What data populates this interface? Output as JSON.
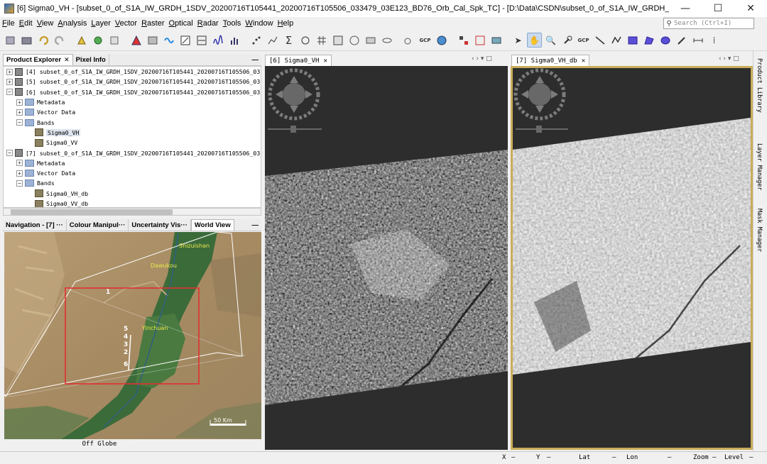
{
  "window": {
    "title": "[6] Sigma0_VH - [subset_0_of_S1A_IW_GRDH_1SDV_20200716T105441_20200716T105506_033479_03E123_BD76_Orb_Cal_Spk_TC] - [D:\\Data\\CSDN\\subset_0_of_S1A_IW_GRDH_1SDV_20200716T105441_2...",
    "minimize": "—",
    "maximize": "☐",
    "close": "✕"
  },
  "menu": [
    "File",
    "Edit",
    "View",
    "Analysis",
    "Layer",
    "Vector",
    "Raster",
    "Optical",
    "Radar",
    "Tools",
    "Window",
    "Help"
  ],
  "search": {
    "placeholder": "Search (Ctrl+I)"
  },
  "toolbar": {
    "gcp_label": "GCP"
  },
  "product_explorer": {
    "tabs": [
      "Product Explorer",
      "Pixel Info"
    ],
    "tab_close": "✕",
    "minimize": "—",
    "tree": [
      {
        "indent": 0,
        "exp": "+",
        "icon": "product",
        "label": "[4] subset_0_of_S1A_IW_GRDH_1SDV_20200716T105441_20200716T105506_03"
      },
      {
        "indent": 0,
        "exp": "+",
        "icon": "product",
        "label": "[5] subset_0_of_S1A_IW_GRDH_1SDV_20200716T105441_20200716T105506_03"
      },
      {
        "indent": 0,
        "exp": "−",
        "icon": "product",
        "label": "[6] subset_0_of_S1A_IW_GRDH_1SDV_20200716T105441_20200716T105506_03"
      },
      {
        "indent": 1,
        "exp": "+",
        "icon": "folder",
        "label": "Metadata"
      },
      {
        "indent": 1,
        "exp": "+",
        "icon": "folder",
        "label": "Vector Data"
      },
      {
        "indent": 1,
        "exp": "−",
        "icon": "folder",
        "label": "Bands"
      },
      {
        "indent": 2,
        "exp": "",
        "icon": "band",
        "label": "Sigma0_VH",
        "selected": true
      },
      {
        "indent": 2,
        "exp": "",
        "icon": "band",
        "label": "Sigma0_VV"
      },
      {
        "indent": 0,
        "exp": "−",
        "icon": "product",
        "label": "[7] subset_0_of_S1A_IW_GRDH_1SDV_20200716T105441_20200716T105506_03"
      },
      {
        "indent": 1,
        "exp": "+",
        "icon": "folder",
        "label": "Metadata"
      },
      {
        "indent": 1,
        "exp": "+",
        "icon": "folder",
        "label": "Vector Data"
      },
      {
        "indent": 1,
        "exp": "−",
        "icon": "folder",
        "label": "Bands"
      },
      {
        "indent": 2,
        "exp": "",
        "icon": "band",
        "label": "Sigma0_VH_db"
      },
      {
        "indent": 2,
        "exp": "",
        "icon": "band",
        "label": "Sigma0_VV_db"
      }
    ]
  },
  "lower_panel": {
    "tabs": [
      "Navigation - [7] ···",
      "Colour Manipul···",
      "Uncertainty Vis···",
      "World View"
    ],
    "minimize": "—",
    "map_labels": {
      "shizuishan": "Shizuishan",
      "dawukou": "Dawukou",
      "yinchuan": "Yinchuan",
      "scale": "50 Km"
    },
    "footprint_numbers": [
      "1",
      "5",
      "4",
      "3",
      "2",
      "6"
    ],
    "off_globe": "Off Globe"
  },
  "view_left": {
    "tab": "[6] Sigma0_VH",
    "close": "✕"
  },
  "view_right": {
    "tab": "[7] Sigma0_VH_db",
    "close": "✕"
  },
  "view_controls": "‹ › ▾ □",
  "side_tabs": [
    "Product Library",
    "Layer Manager",
    "Mask Manager"
  ],
  "status": {
    "x": "X",
    "y": "Y",
    "lat": "Lat",
    "lon": "Lon",
    "zoom": "Zoom",
    "level": "Level",
    "dash": "—"
  }
}
